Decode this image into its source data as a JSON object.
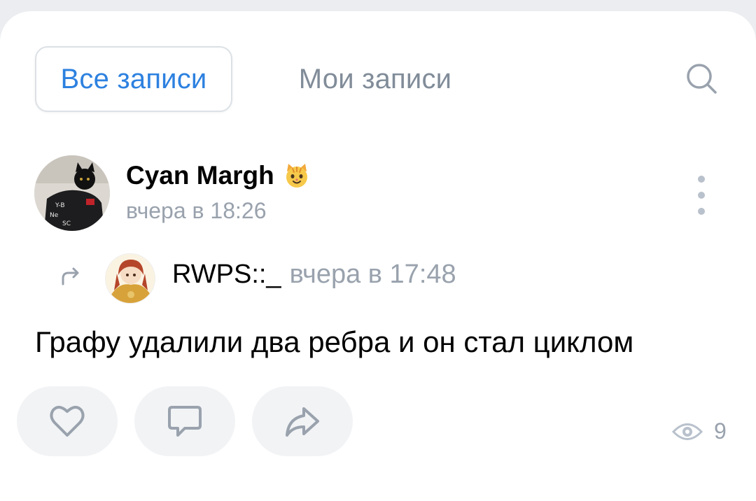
{
  "tabs": {
    "all_posts": "Все записи",
    "my_posts": "Мои записи"
  },
  "post": {
    "author": "Cyan Margh",
    "author_emoji": "🐱",
    "time": "вчера в 18:26",
    "repost": {
      "author": "RWPS::_",
      "time": "вчера в 17:48"
    },
    "text": "Графу удалили два ребра и он стал циклом",
    "views": "9"
  },
  "colors": {
    "accent": "#2d81e0",
    "secondary_text": "#99a2ad",
    "icon_gray": "#99a2ad",
    "button_bg": "#f2f3f5"
  },
  "icons": [
    "search-icon",
    "more-vertical-icon",
    "repost-arrow-icon",
    "like-heart-icon",
    "comment-icon",
    "share-icon",
    "views-eye-icon"
  ]
}
